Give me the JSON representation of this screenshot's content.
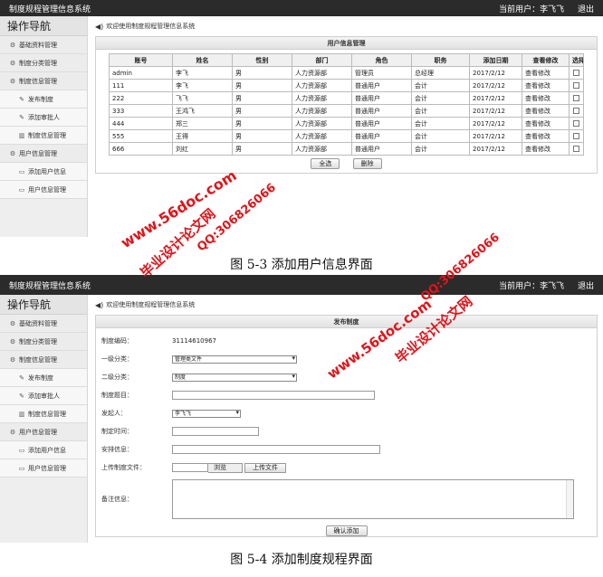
{
  "app": {
    "title": "制度规程管理信息系统",
    "current_user": "当前用户：李飞飞",
    "logout": "退出"
  },
  "nav": {
    "title": "操作导航",
    "items": [
      {
        "label": "基础资料管理",
        "icon": "gear-icon",
        "sub": false
      },
      {
        "label": "制度分类管理",
        "icon": "gear-icon",
        "sub": false
      },
      {
        "label": "制度信息管理",
        "icon": "gear-icon",
        "sub": false
      },
      {
        "label": "发布制度",
        "icon": "wrench-icon",
        "sub": true
      },
      {
        "label": "添加审批人",
        "icon": "wrench-icon",
        "sub": true
      },
      {
        "label": "制度信息管理",
        "icon": "trash-icon",
        "sub": true
      },
      {
        "label": "用户信息管理",
        "icon": "gear-icon",
        "sub": false
      },
      {
        "label": "添加用户信息",
        "icon": "document-icon",
        "sub": true
      },
      {
        "label": "用户信息管理",
        "icon": "document-icon",
        "sub": true
      }
    ]
  },
  "welcome": "欢迎使用制度规程管理信息系统",
  "user_panel": {
    "title": "用户信息管理",
    "columns": [
      "账号",
      "姓名",
      "性别",
      "部门",
      "角色",
      "职务",
      "添加日期",
      "查看修改",
      "选择"
    ],
    "rows": [
      [
        "admin",
        "李飞",
        "男",
        "人力资源部",
        "管理员",
        "总经理",
        "2017/2/12",
        "查看修改"
      ],
      [
        "111",
        "李飞",
        "男",
        "人力资源部",
        "普通用户",
        "会计",
        "2017/2/12",
        "查看修改"
      ],
      [
        "222",
        "飞飞",
        "男",
        "人力资源部",
        "普通用户",
        "会计",
        "2017/2/12",
        "查看修改"
      ],
      [
        "333",
        "王鸿飞",
        "男",
        "人力资源部",
        "普通用户",
        "会计",
        "2017/2/12",
        "查看修改"
      ],
      [
        "444",
        "郑三",
        "男",
        "人力资源部",
        "普通用户",
        "会计",
        "2017/2/12",
        "查看修改"
      ],
      [
        "555",
        "王得",
        "男",
        "人力资源部",
        "普通用户",
        "会计",
        "2017/2/12",
        "查看修改"
      ],
      [
        "666",
        "刘红",
        "男",
        "人力资源部",
        "普通用户",
        "会计",
        "2017/2/12",
        "查看修改"
      ]
    ],
    "select_all": "全选",
    "delete": "删除"
  },
  "captions": {
    "fig1": "图 5-3 添加用户信息界面",
    "fig2": "图 5-4 添加制度规程界面"
  },
  "publish_panel": {
    "title": "发布制度",
    "code_label": "制度编码：",
    "code_value": "31114610967",
    "cat1_label": "一级分类：",
    "cat1_value": "管理类文件",
    "cat2_label": "二级分类：",
    "cat2_value": "制度",
    "name_label": "制度题目：",
    "name_value": "",
    "publisher_label": "发起人：",
    "publisher_value": "李飞飞",
    "time_label": "制定时间：",
    "time_value": "",
    "arrange_label": "安排信息：",
    "arrange_value": "",
    "file_label": "上传制度文件：",
    "browse": "浏览",
    "upload": "上传文件",
    "note_label": "备注信息：",
    "note_value": "",
    "submit": "确认添加"
  },
  "watermarks": {
    "cn": "毕业设计论文网",
    "site": "www.56doc.com",
    "qq": "QQ:306826066"
  },
  "colors": {
    "topbar": "#2b2b2b",
    "sidebar": "#eeeeee",
    "watermark": "#e2141a"
  }
}
